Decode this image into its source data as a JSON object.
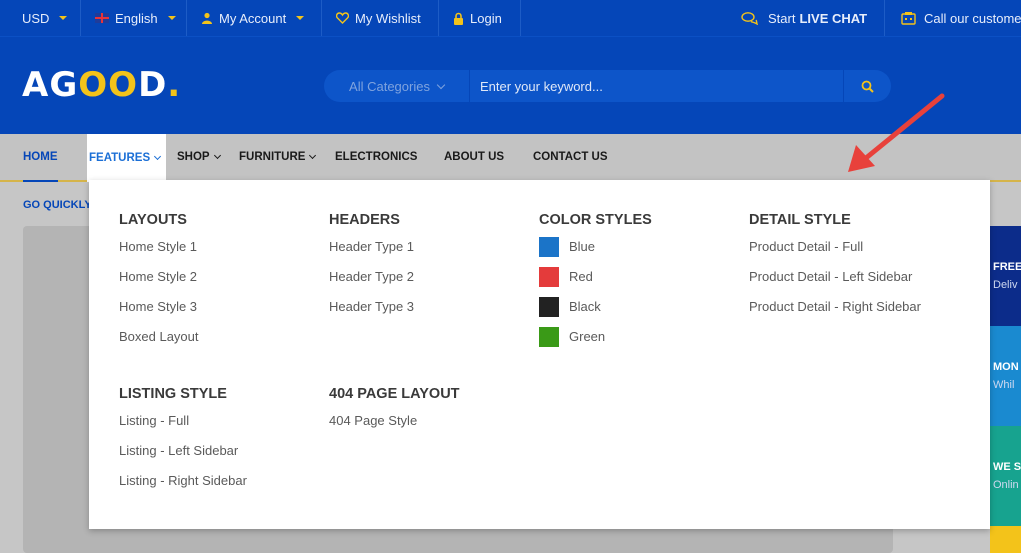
{
  "topbar": {
    "currency": "USD",
    "language": "English",
    "account": "My Account",
    "wishlist": "My Wishlist",
    "login": "Login",
    "live_chat_prefix": "Start",
    "live_chat_strong": "LIVE CHAT",
    "call": "Call our custome"
  },
  "header": {
    "logo_a": "A",
    "logo_g": "G",
    "logo_oo": "OO",
    "logo_d": "D",
    "logo_dot": ".",
    "search_category": "All Categories",
    "search_placeholder": "Enter your keyword..."
  },
  "nav": {
    "home": "HOME",
    "features": "FEATURES",
    "shop": "SHOP",
    "furniture": "FURNITURE",
    "electronics": "ELECTRONICS",
    "about": "ABOUT US",
    "contact": "CONTACT US"
  },
  "below": {
    "go_quickly": "GO QUICKLY",
    "side1_title": "FREE",
    "side1_sub": "Deliv",
    "side2_title": "MON",
    "side2_sub": "Whil",
    "side3_title": "WE S",
    "side3_sub": "Onlin"
  },
  "colors": {
    "blue": "#1b74c8",
    "red": "#e43b3b",
    "black": "#222222",
    "green": "#3a9a17",
    "side1": "#0c2c8a",
    "side2": "#1a8ad0",
    "side3": "#17a38f",
    "side4": "#f3c31a"
  },
  "mega": {
    "layouts": {
      "title": "LAYOUTS",
      "items": [
        "Home Style 1",
        "Home Style 2",
        "Home Style 3",
        "Boxed Layout"
      ]
    },
    "headers": {
      "title": "HEADERS",
      "items": [
        "Header Type 1",
        "Header Type 2",
        "Header Type 3"
      ]
    },
    "color_styles": {
      "title": "COLOR STYLES",
      "items": [
        "Blue",
        "Red",
        "Black",
        "Green"
      ]
    },
    "detail_style": {
      "title": "DETAIL STYLE",
      "items": [
        "Product Detail - Full",
        "Product Detail - Left Sidebar",
        "Product Detail - Right Sidebar"
      ]
    },
    "listing_style": {
      "title": "LISTING STYLE",
      "items": [
        "Listing - Full",
        "Listing - Left Sidebar",
        "Listing - Right Sidebar"
      ]
    },
    "page_404": {
      "title": "404 PAGE LAYOUT",
      "items": [
        "404 Page Style"
      ]
    }
  }
}
